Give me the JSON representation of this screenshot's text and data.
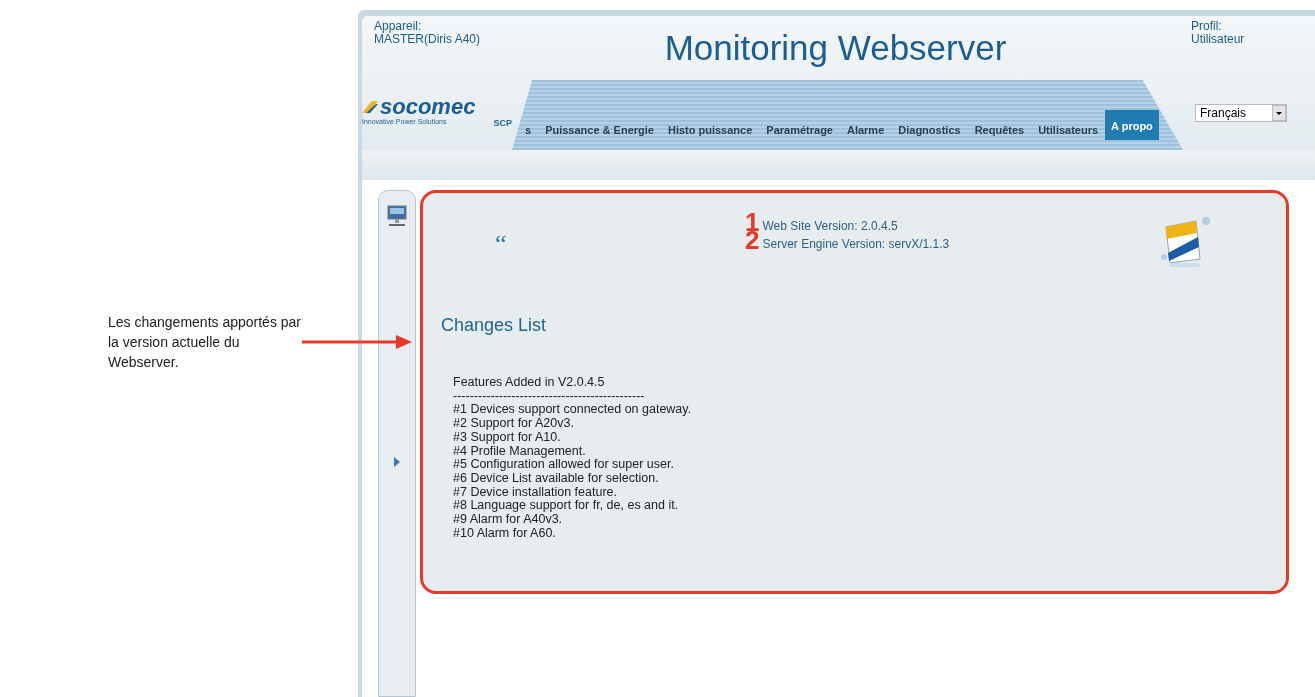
{
  "annotation": {
    "text": "Les changements apportés par la version actuelle du Webserver."
  },
  "header": {
    "device_label": "Appareil:",
    "device_value": "MASTER(Diris A40)",
    "title": "Monitoring Webserver",
    "profile_label": "Profil:",
    "profile_value": "Utilisateur"
  },
  "logo": {
    "name": "socomec",
    "tagline": "Innovative Power Solutions",
    "suffix": "SCP"
  },
  "nav_tabs": [
    {
      "label": "s",
      "selected": false
    },
    {
      "label": "Puissance & Energie",
      "selected": false
    },
    {
      "label": "Histo puissance",
      "selected": false
    },
    {
      "label": "Paramétrage",
      "selected": false
    },
    {
      "label": "Alarme",
      "selected": false
    },
    {
      "label": "Diagnostics",
      "selected": false
    },
    {
      "label": "Requêtes",
      "selected": false
    },
    {
      "label": "Utilisateurs",
      "selected": false
    },
    {
      "label": "A propo",
      "selected": true
    }
  ],
  "language_select": {
    "value": "Français"
  },
  "content": {
    "quote_mark": "“",
    "versions": [
      {
        "marker": "1",
        "text": "Web Site Version: 2.0.4.5"
      },
      {
        "marker": "2",
        "text": "Server Engine Version: servX/1.1.3"
      }
    ],
    "heading": "Changes List",
    "changes": [
      "Features Added in V2.0.4.5",
      "----------------------------------------------",
      "#1 Devices support connected on gateway.",
      "#2 Support for A20v3.",
      "#3 Support for A10.",
      "#4 Profile Management.",
      "#5 Configuration allowed for super user.",
      "#6 Device List available for selection.",
      "#7 Device installation feature.",
      "#8 Language support for fr, de, es and it.",
      "#9 Alarm for A40v3.",
      "#10 Alarm for A60."
    ]
  }
}
